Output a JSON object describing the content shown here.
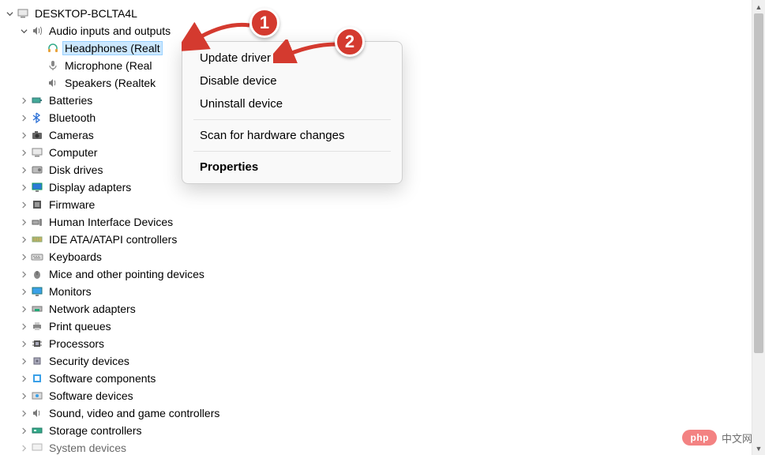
{
  "root": {
    "label": "DESKTOP-BCLTA4L",
    "expanded": true
  },
  "audio": {
    "label": "Audio inputs and outputs",
    "children": {
      "headphones": "Headphones (Realtek(R) Audio)",
      "headphones_truncated": "Headphones (Realt",
      "microphone_truncated": "Microphone (Real",
      "speakers_truncated": "Speakers (Realtek"
    }
  },
  "categories": {
    "batteries": "Batteries",
    "bluetooth": "Bluetooth",
    "cameras": "Cameras",
    "computer": "Computer",
    "disk_drives": "Disk drives",
    "display_adapters": "Display adapters",
    "firmware": "Firmware",
    "hid": "Human Interface Devices",
    "ide": "IDE ATA/ATAPI controllers",
    "keyboards": "Keyboards",
    "mice": "Mice and other pointing devices",
    "monitors": "Monitors",
    "network": "Network adapters",
    "print_queues": "Print queues",
    "processors": "Processors",
    "security": "Security devices",
    "software_components": "Software components",
    "software_devices": "Software devices",
    "sound": "Sound, video and game controllers",
    "storage": "Storage controllers",
    "system": "System devices"
  },
  "context_menu": {
    "update": "Update driver",
    "disable": "Disable device",
    "uninstall": "Uninstall device",
    "scan": "Scan for hardware changes",
    "properties": "Properties"
  },
  "callouts": {
    "one": "1",
    "two": "2"
  },
  "watermark": {
    "pill": "php",
    "text": "中文网"
  }
}
